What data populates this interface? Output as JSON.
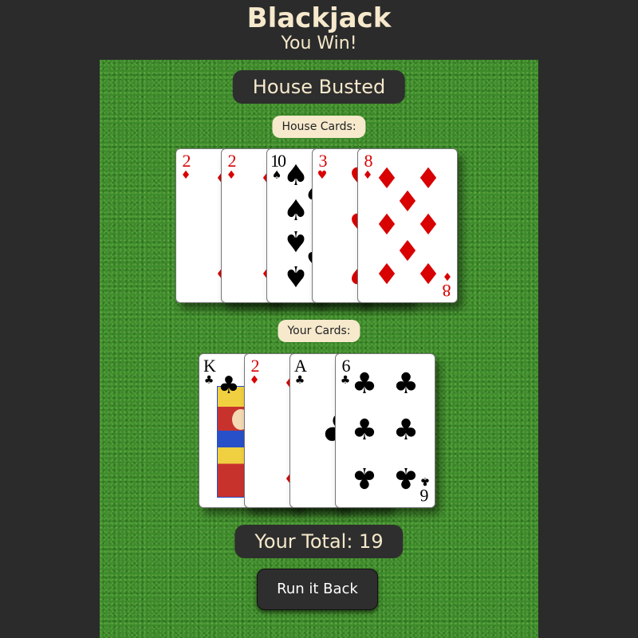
{
  "header": {
    "title": "Blackjack",
    "subtitle": "You Win!"
  },
  "status": "House Busted",
  "house": {
    "label": "House Cards:",
    "cards": [
      {
        "rank": "2",
        "suit": "♦",
        "color": "red"
      },
      {
        "rank": "2",
        "suit": "♦",
        "color": "red"
      },
      {
        "rank": "10",
        "suit": "♠",
        "color": "black"
      },
      {
        "rank": "3",
        "suit": "♥",
        "color": "red"
      },
      {
        "rank": "8",
        "suit": "♦",
        "color": "red"
      }
    ]
  },
  "player": {
    "label": "Your Cards:",
    "cards": [
      {
        "rank": "K",
        "suit": "♣",
        "color": "black"
      },
      {
        "rank": "2",
        "suit": "♦",
        "color": "red"
      },
      {
        "rank": "A",
        "suit": "♣",
        "color": "black"
      },
      {
        "rank": "6",
        "suit": "♣",
        "color": "black"
      }
    ]
  },
  "total_text": "Your Total: 19",
  "button_label": "Run it Back",
  "colors": {
    "background": "#2b2b2b",
    "felt": "#3d8a2a",
    "cream": "#f6e9cc",
    "red": "#d80000"
  }
}
